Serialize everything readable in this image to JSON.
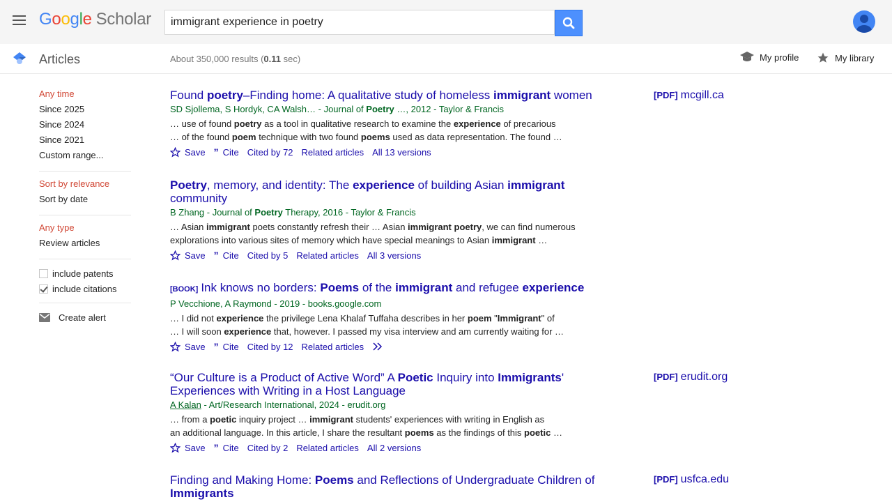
{
  "header": {
    "logo_google": "Google",
    "logo_scholar": "Scholar",
    "search_value": "immigrant experience in poetry"
  },
  "subheader": {
    "section_label": "Articles",
    "results_prefix": "About 350,000 results (",
    "results_time": "0.11",
    "results_suffix": " sec)",
    "my_profile": "My profile",
    "my_library": "My library"
  },
  "sidebar": {
    "time_filters": [
      "Any time",
      "Since 2025",
      "Since 2024",
      "Since 2021",
      "Custom range..."
    ],
    "sort_options": [
      "Sort by relevance",
      "Sort by date"
    ],
    "type_filters": [
      "Any type",
      "Review articles"
    ],
    "include_patents": "include patents",
    "include_citations": "include citations",
    "create_alert": "Create alert"
  },
  "results": [
    {
      "title_html": "Found <b>poetry</b>–Finding home: A qualitative study of homeless <b>immigrant</b> women",
      "meta_html": "SD Sjollema, S Hordyk, CA Walsh… - Journal of <b>Poetry</b> …, 2012 - Taylor &amp; Francis",
      "snippet_html": "… use of found <b>poetry</b> as a tool in qualitative research to examine the <b>experience</b> of precarious<br>… of the found <b>poem</b> technique with two found <b>poems</b> used as data representation. The found …",
      "save": "Save",
      "cite": "Cite",
      "cited_by": "Cited by 72",
      "related": "Related articles",
      "versions": "All 13 versions",
      "pdf_tag": "[PDF]",
      "source": "mcgill.ca"
    },
    {
      "title_html": "<b>Poetry</b>, memory, and identity: The <b>experience</b> of building Asian <b>immigrant</b> community",
      "meta_html": "B Zhang - Journal of <b>Poetry</b> Therapy, 2016 - Taylor &amp; Francis",
      "snippet_html": "… Asian <b>immigrant</b> poets constantly refresh their … Asian <b>immigrant poetry</b>, we can find numerous<br>explorations into various sites of memory which have special meanings to Asian <b>immigrant</b> …",
      "save": "Save",
      "cite": "Cite",
      "cited_by": "Cited by 5",
      "related": "Related articles",
      "versions": "All 3 versions"
    },
    {
      "book_tag": "[BOOK]",
      "title_html": "Ink knows no borders: <b>Poems</b> of the <b>immigrant</b> and refugee <b>experience</b>",
      "meta_html": "P Vecchione, A Raymond - 2019 - books.google.com",
      "snippet_html": "… I did not <b>experience</b> the privilege Lena Khalaf Tuffaha describes in her <b>poem</b> \"<b>Immigrant</b>\" of<br>… I will soon <b>experience</b> that, however. I passed my visa interview and am currently waiting for …",
      "save": "Save",
      "cite": "Cite",
      "cited_by": "Cited by 12",
      "related": "Related articles"
    },
    {
      "title_html": "“Our Culture is a Product of Active Word” A <b>Poetic</b> Inquiry into <b>Immigrants</b>' Experiences with Writing in a Host Language",
      "meta_html": "<span class=\"u\">A Kalan</span> - Art/Research International, 2024 - erudit.org",
      "snippet_html": "… from a <b>poetic</b> inquiry project … <b>immigrant</b> students' experiences with writing in English as<br>an additional language. In this article, I share the resultant <b>poems</b> as the findings of this <b>poetic</b> …",
      "save": "Save",
      "cite": "Cite",
      "cited_by": "Cited by 2",
      "related": "Related articles",
      "versions": "All 2 versions",
      "pdf_tag": "[PDF]",
      "source": "erudit.org"
    },
    {
      "title_html": "Finding and Making Home: <b>Poems</b> and Reflections of Undergraduate Children of <b>Immigrants</b>",
      "pdf_tag": "[PDF]",
      "source": "usfca.edu"
    }
  ]
}
